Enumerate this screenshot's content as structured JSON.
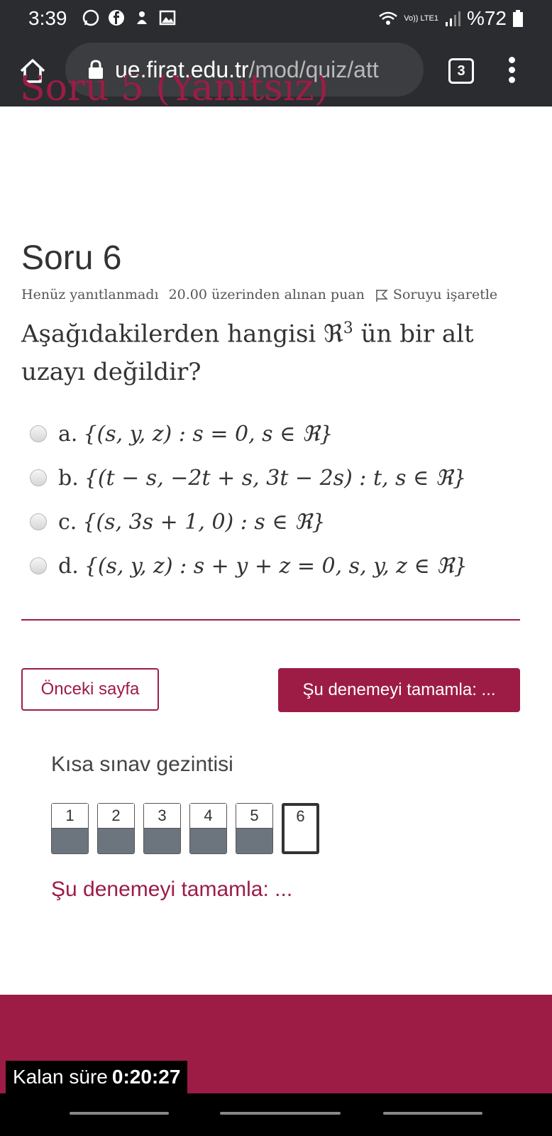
{
  "status_bar": {
    "time": "3:39",
    "network": "Vo)) LTE1",
    "battery": "%72",
    "icons": [
      "whatsapp-icon",
      "facebook-icon",
      "notification-icon",
      "gallery-icon",
      "wifi-icon",
      "signal-icon",
      "battery-icon"
    ]
  },
  "browser": {
    "url_host": "ue.firat.edu.tr",
    "url_path": "/mod/quiz/att",
    "tab_count": "3"
  },
  "cut_heading": "Soru 5 (Yanıtsız)",
  "question": {
    "title": "Soru 6",
    "state": "Henüz yanıtlanmadı",
    "grade": "20.00 üzerinden alınan puan",
    "flag_label": "Soruyu işaretle",
    "text_before": "Aşağıdakilerden hangisi ",
    "text_symbol": "ℜ",
    "text_sup": "3",
    "text_after": " ün bir alt uzayı değildir?",
    "answers": [
      {
        "letter": "a.",
        "text": "{(s, y, z) : s = 0, s ∈ ℜ}"
      },
      {
        "letter": "b.",
        "text": "{(t − s, −2t + s, 3t − 2s) : t, s ∈ ℜ}"
      },
      {
        "letter": "c.",
        "text": "{(s, 3s + 1, 0) : s ∈ ℜ}"
      },
      {
        "letter": "d.",
        "text": "{(s, y, z) : s + y + z = 0, s, y, z ∈ ℜ}"
      }
    ]
  },
  "buttons": {
    "prev": "Önceki sayfa",
    "finish": "Şu denemeyi tamamla: ..."
  },
  "nav": {
    "title": "Kısa sınav gezintisi",
    "items": [
      {
        "num": "1",
        "answered": true
      },
      {
        "num": "2",
        "answered": true
      },
      {
        "num": "3",
        "answered": true
      },
      {
        "num": "4",
        "answered": true
      },
      {
        "num": "5",
        "answered": true
      },
      {
        "num": "6",
        "answered": false,
        "current": true
      }
    ],
    "finish_link": "Şu denemeyi tamamla: ..."
  },
  "timer": {
    "label": "Kalan süre",
    "value": "0:20:27"
  },
  "colors": {
    "accent": "#9d1c45",
    "chrome": "#2b2c2f",
    "answered_fill": "#6c757d"
  }
}
